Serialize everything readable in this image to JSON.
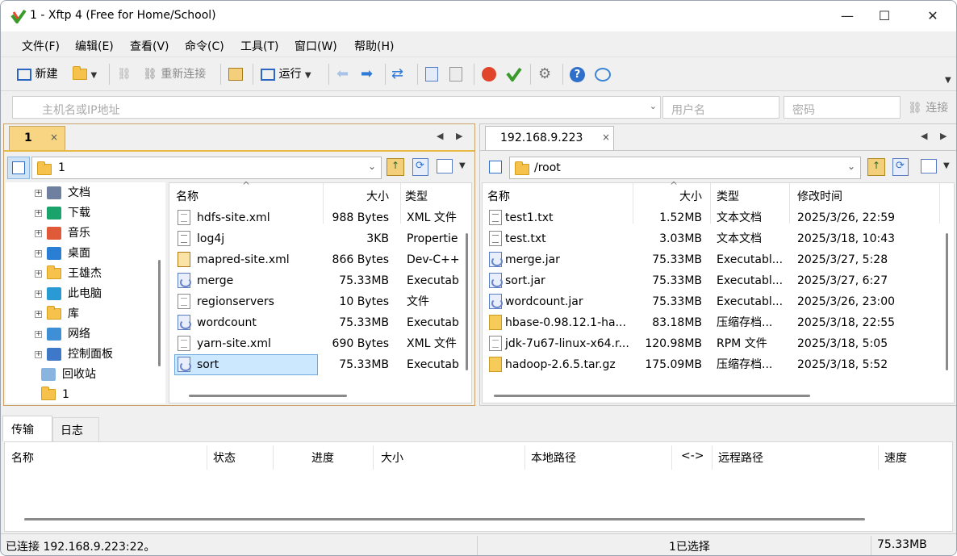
{
  "window": {
    "title": "1 - Xftp 4 (Free for Home/School)"
  },
  "menu": [
    "文件(F)",
    "编辑(E)",
    "查看(V)",
    "命令(C)",
    "工具(T)",
    "窗口(W)",
    "帮助(H)"
  ],
  "toolbar": {
    "new_label": "新建",
    "reconnect_label": "重新连接",
    "run_label": "运行"
  },
  "connect_bar": {
    "host_placeholder": "主机名或IP地址",
    "user_placeholder": "用户名",
    "password_placeholder": "密码",
    "connect_label": "连接"
  },
  "local": {
    "tab_label": "1",
    "tab_close": "×",
    "path": "1",
    "tree": [
      "文档",
      "下载",
      "音乐",
      "桌面",
      "王雄杰",
      "此电脑",
      "库",
      "网络",
      "控制面板",
      "回收站",
      "1"
    ],
    "columns": [
      "名称",
      "大小",
      "类型"
    ],
    "files": [
      {
        "name": "hdfs-site.xml",
        "size": "988 Bytes",
        "type": "XML 文件",
        "icon": "xml"
      },
      {
        "name": "log4j",
        "size": "3KB",
        "type": "Propertie",
        "icon": "txt"
      },
      {
        "name": "mapred-site.xml",
        "size": "866 Bytes",
        "type": "Dev-C++",
        "icon": "mr"
      },
      {
        "name": "merge",
        "size": "75.33MB",
        "type": "Executab",
        "icon": "jar"
      },
      {
        "name": "regionservers",
        "size": "10 Bytes",
        "type": "文件",
        "icon": "xml"
      },
      {
        "name": "wordcount",
        "size": "75.33MB",
        "type": "Executab",
        "icon": "jar"
      },
      {
        "name": "yarn-site.xml",
        "size": "690 Bytes",
        "type": "XML 文件",
        "icon": "xml"
      },
      {
        "name": "sort",
        "size": "75.33MB",
        "type": "Executab",
        "icon": "jar"
      }
    ]
  },
  "remote": {
    "tab_label": "192.168.9.223",
    "tab_close": "×",
    "path": "/root",
    "columns": [
      "名称",
      "大小",
      "类型",
      "修改时间"
    ],
    "files": [
      {
        "name": "test1.txt",
        "size": "1.52MB",
        "type": "文本文档",
        "modified": "2025/3/26, 22:59",
        "icon": "txt"
      },
      {
        "name": "test.txt",
        "size": "3.03MB",
        "type": "文本文档",
        "modified": "2025/3/18, 10:43",
        "icon": "txt"
      },
      {
        "name": "merge.jar",
        "size": "75.33MB",
        "type": "Executabl...",
        "modified": "2025/3/27, 5:28",
        "icon": "jar"
      },
      {
        "name": "sort.jar",
        "size": "75.33MB",
        "type": "Executabl...",
        "modified": "2025/3/27, 6:27",
        "icon": "jar"
      },
      {
        "name": "wordcount.jar",
        "size": "75.33MB",
        "type": "Executabl...",
        "modified": "2025/3/26, 23:00",
        "icon": "jar"
      },
      {
        "name": "hbase-0.98.12.1-ha...",
        "size": "83.18MB",
        "type": "压缩存档...",
        "modified": "2025/3/18, 22:55",
        "icon": "zip"
      },
      {
        "name": "jdk-7u67-linux-x64.r...",
        "size": "120.98MB",
        "type": "RPM 文件",
        "modified": "2025/3/18, 5:05",
        "icon": "xml"
      },
      {
        "name": "hadoop-2.6.5.tar.gz",
        "size": "175.09MB",
        "type": "压缩存档...",
        "modified": "2025/3/18, 5:52",
        "icon": "zip"
      }
    ]
  },
  "transfer": {
    "tabs": [
      "传输",
      "日志"
    ],
    "columns": [
      "名称",
      "状态",
      "进度",
      "大小",
      "本地路径",
      "<->",
      "远程路径",
      "速度"
    ]
  },
  "status": {
    "connection": "已连接 192.168.9.223:22。",
    "selection": "1已选择",
    "size": "75.33MB"
  },
  "colors": {
    "panel_border": "#c8a468",
    "selected_row": "#cce8ff",
    "folder": "#f6c24b"
  }
}
